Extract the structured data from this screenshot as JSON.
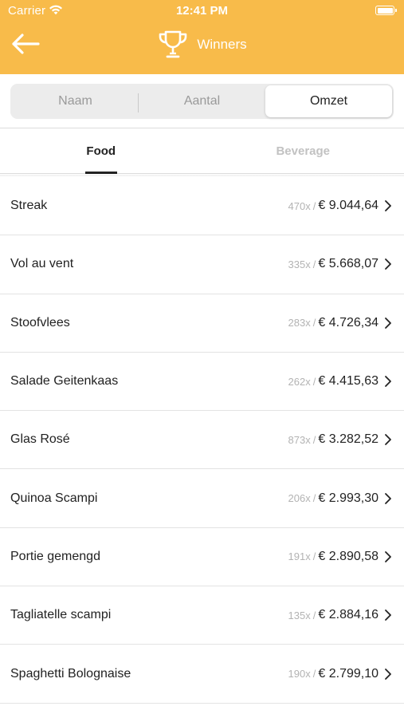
{
  "status_bar": {
    "carrier": "Carrier",
    "time": "12:41 PM"
  },
  "nav": {
    "title": "Winners",
    "back_icon": "arrow-left-icon",
    "title_icon": "trophy-icon"
  },
  "segment": {
    "options": [
      {
        "label": "Naam"
      },
      {
        "label": "Aantal"
      },
      {
        "label": "Omzet"
      }
    ],
    "selected": "Omzet"
  },
  "tabs": [
    {
      "label": "Food"
    },
    {
      "label": "Beverage"
    }
  ],
  "active_tab": "Food",
  "items": [
    {
      "name": "Streak",
      "count": "470x",
      "separator": "/",
      "amount": "€ 9.044,64"
    },
    {
      "name": "Vol au vent",
      "count": "335x",
      "separator": "/",
      "amount": "€ 5.668,07"
    },
    {
      "name": "Stoofvlees",
      "count": "283x",
      "separator": "/",
      "amount": "€ 4.726,34"
    },
    {
      "name": "Salade Geitenkaas",
      "count": "262x",
      "separator": "/",
      "amount": "€ 4.415,63"
    },
    {
      "name": "Glas Rosé",
      "count": "873x",
      "separator": "/",
      "amount": "€ 3.282,52"
    },
    {
      "name": "Quinoa Scampi",
      "count": "206x",
      "separator": "/",
      "amount": "€ 2.993,30"
    },
    {
      "name": "Portie gemengd",
      "count": "191x",
      "separator": "/",
      "amount": "€ 2.890,58"
    },
    {
      "name": "Tagliatelle scampi",
      "count": "135x",
      "separator": "/",
      "amount": "€ 2.884,16"
    },
    {
      "name": "Spaghetti Bolognaise",
      "count": "190x",
      "separator": "/",
      "amount": "€ 2.799,10"
    }
  ],
  "colors": {
    "header": "#f8bb4a",
    "text": "#222222",
    "muted": "#b3b3b3"
  }
}
